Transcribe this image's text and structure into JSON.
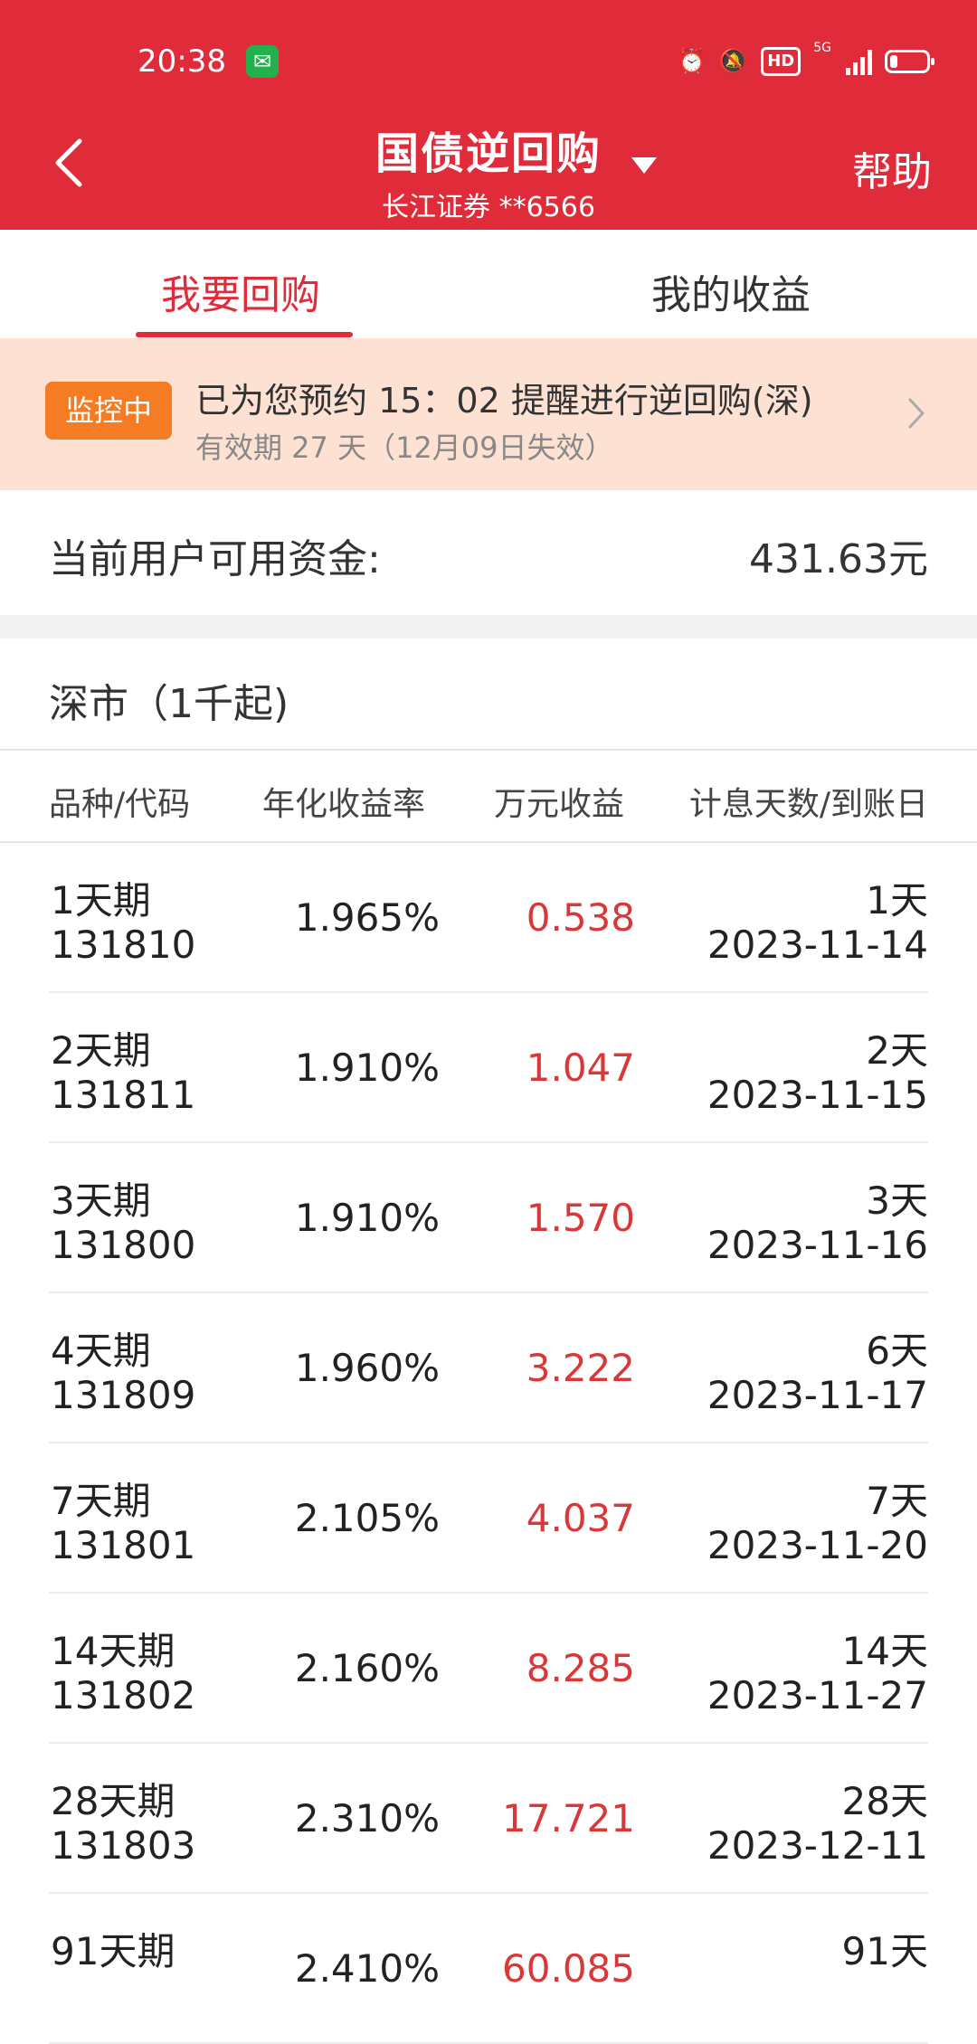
{
  "status_bar": {
    "time": "20:38",
    "network": "5G",
    "icons": [
      "wechat-icon",
      "alarm-icon",
      "mute-icon",
      "hd-icon",
      "signal-icon",
      "battery-icon"
    ],
    "battery_level": 0.2
  },
  "header": {
    "title": "国债逆回购",
    "subtitle": "长江证券 **6566",
    "help_label": "帮助",
    "hd_label": "HD",
    "background_color": "#e02c3a"
  },
  "tabs": [
    {
      "label": "我要回购",
      "active": true
    },
    {
      "label": "我的收益",
      "active": false
    }
  ],
  "monitor": {
    "badge": "监控中",
    "message": "已为您预约 15：02 提醒进行逆回购(深)",
    "validity": "有效期 27 天（12月09日失效）",
    "badge_color": "#f57c23"
  },
  "balance": {
    "label": "当前用户可用资金:",
    "value": "431.63元"
  },
  "market": {
    "title": "深市（1千起)",
    "columns": [
      "品种/代码",
      "年化收益率",
      "万元收益",
      "计息天数/到账日"
    ],
    "rows": [
      {
        "name": "1天期",
        "code": "131810",
        "rate": "1.965%",
        "gain": "0.538",
        "days": "1天",
        "date": "2023-11-14"
      },
      {
        "name": "2天期",
        "code": "131811",
        "rate": "1.910%",
        "gain": "1.047",
        "days": "2天",
        "date": "2023-11-15"
      },
      {
        "name": "3天期",
        "code": "131800",
        "rate": "1.910%",
        "gain": "1.570",
        "days": "3天",
        "date": "2023-11-16"
      },
      {
        "name": "4天期",
        "code": "131809",
        "rate": "1.960%",
        "gain": "3.222",
        "days": "6天",
        "date": "2023-11-17"
      },
      {
        "name": "7天期",
        "code": "131801",
        "rate": "2.105%",
        "gain": "4.037",
        "days": "7天",
        "date": "2023-11-20"
      },
      {
        "name": "14天期",
        "code": "131802",
        "rate": "2.160%",
        "gain": "8.285",
        "days": "14天",
        "date": "2023-11-27"
      },
      {
        "name": "28天期",
        "code": "131803",
        "rate": "2.310%",
        "gain": "17.721",
        "days": "28天",
        "date": "2023-12-11"
      },
      {
        "name": "91天期",
        "code": "",
        "rate": "2.410%",
        "gain": "60.085",
        "days": "91天",
        "date": ""
      }
    ],
    "gain_color": "#d83838"
  }
}
